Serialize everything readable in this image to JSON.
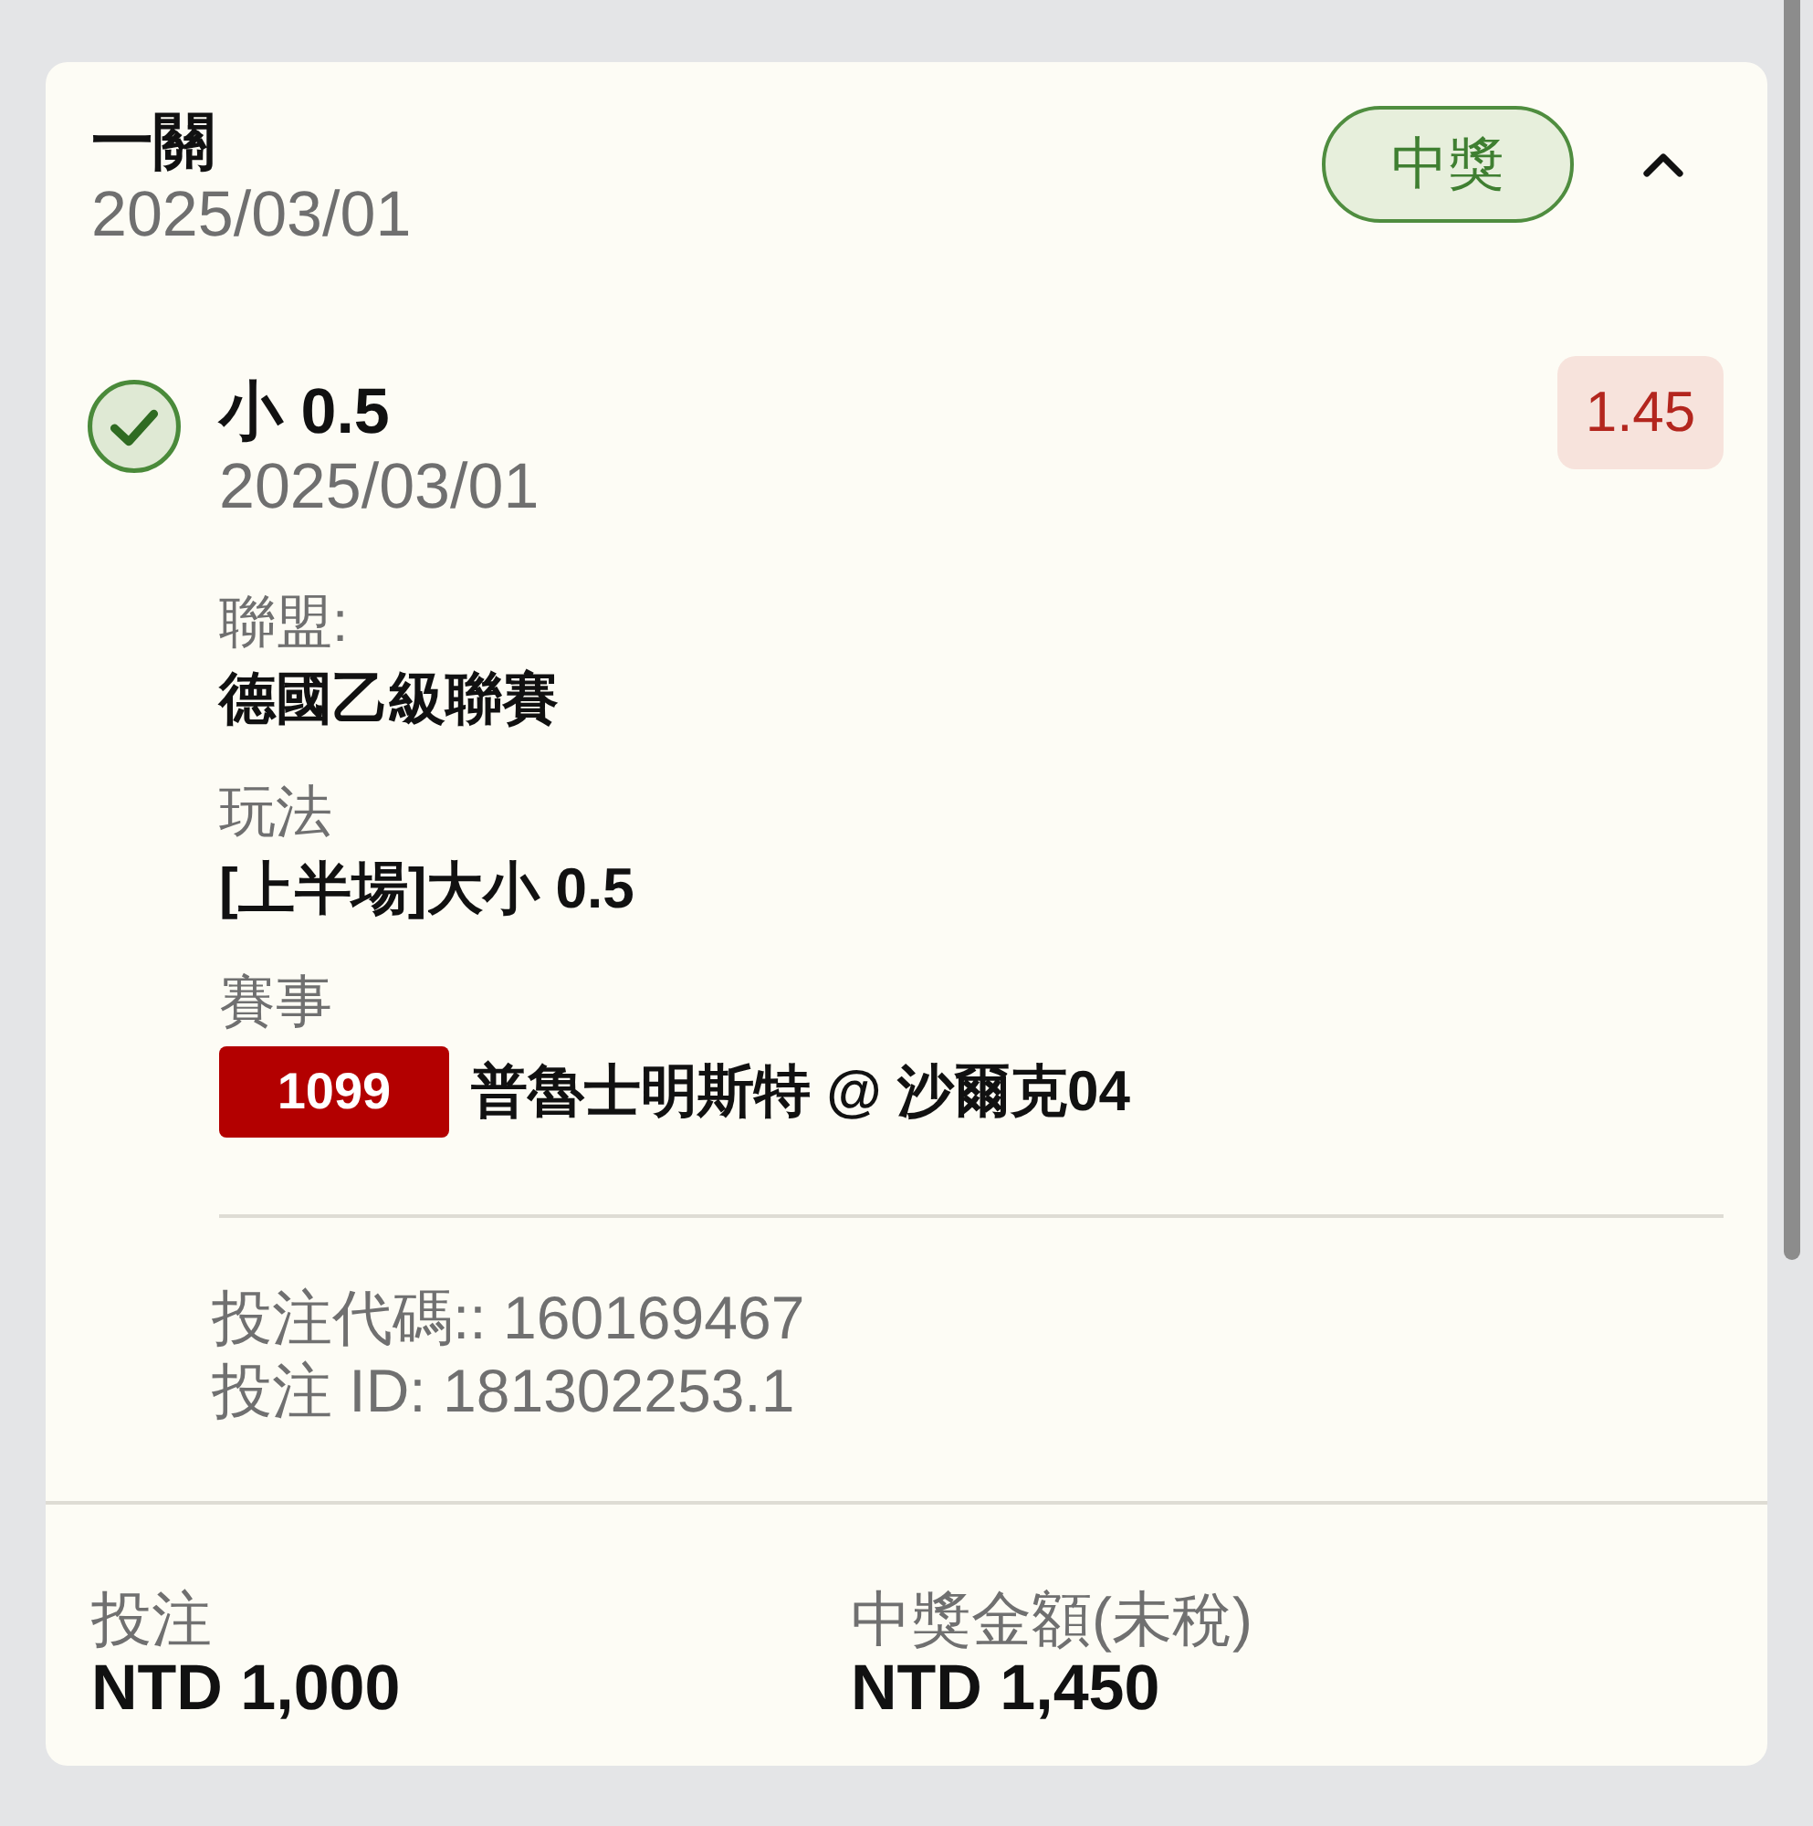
{
  "bet": {
    "title": "一關",
    "date": "2025/03/01",
    "status": {
      "label": "中獎",
      "kind": "won"
    },
    "expanded": true
  },
  "selections": [
    {
      "won": true,
      "pick": "小 0.5",
      "date": "2025/03/01",
      "odds": "1.45",
      "details": [
        {
          "label": "聯盟:",
          "value": "德國乙級聯賽"
        },
        {
          "label": "玩法",
          "value": "[上半場]大小 0.5"
        },
        {
          "label": "賽事",
          "match_no": "1099",
          "value": "普魯士明斯特 @ 沙爾克04"
        }
      ]
    }
  ],
  "references": [
    "投注代碼:: 160169467",
    "投注 ID: 181302253.1"
  ],
  "summary": [
    {
      "label": "投注",
      "value": "NTD 1,000"
    },
    {
      "label": "中獎金額(未稅)",
      "value": "NTD 1,450"
    }
  ]
}
